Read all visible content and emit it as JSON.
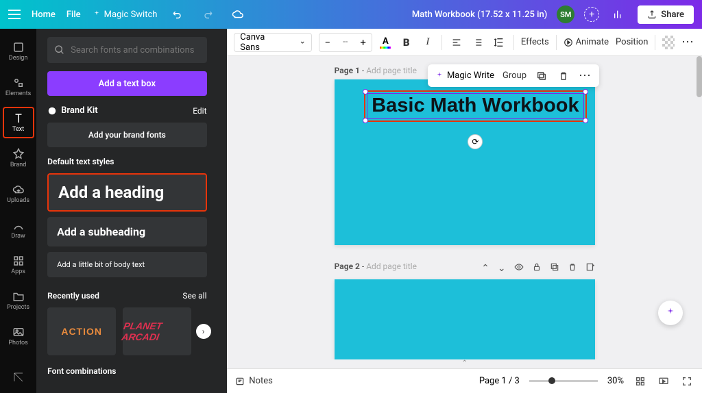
{
  "topbar": {
    "home": "Home",
    "file": "File",
    "magic_switch": "Magic Switch",
    "doc_name": "Math Workbook (17.52 x 11.25 in)",
    "avatar": "SM",
    "share": "Share"
  },
  "rail": {
    "design": "Design",
    "elements": "Elements",
    "text": "Text",
    "brand": "Brand",
    "uploads": "Uploads",
    "draw": "Draw",
    "apps": "Apps",
    "projects": "Projects",
    "photos": "Photos"
  },
  "panel": {
    "search_placeholder": "Search fonts and combinations",
    "add_textbox": "Add a text box",
    "brandkit": "Brand Kit",
    "edit": "Edit",
    "add_brand_fonts": "Add your brand fonts",
    "default_styles": "Default text styles",
    "heading": "Add a heading",
    "subheading": "Add a subheading",
    "body": "Add a little bit of body text",
    "recently_used": "Recently used",
    "see_all": "See all",
    "recent1": "ACTION",
    "recent2": "PLANET ARCADI",
    "combos": "Font combinations"
  },
  "toolbar": {
    "font": "Canva Sans",
    "size_placeholder": "--",
    "effects": "Effects",
    "animate": "Animate",
    "position": "Position"
  },
  "float_toolbar": {
    "magic_write": "Magic Write",
    "group": "Group"
  },
  "canvas": {
    "page1_label": "Page 1",
    "page2_label": "Page 2",
    "page_title_ph": "Add page title",
    "textbox": "Basic Math Workbook"
  },
  "bottombar": {
    "notes": "Notes",
    "page_count": "Page 1 / 3",
    "zoom": "30%"
  },
  "colors": {
    "accent": "#8b3dff",
    "page_bg": "#1dbfd9",
    "highlight": "#e8340a",
    "selection": "#7d2ae8"
  }
}
